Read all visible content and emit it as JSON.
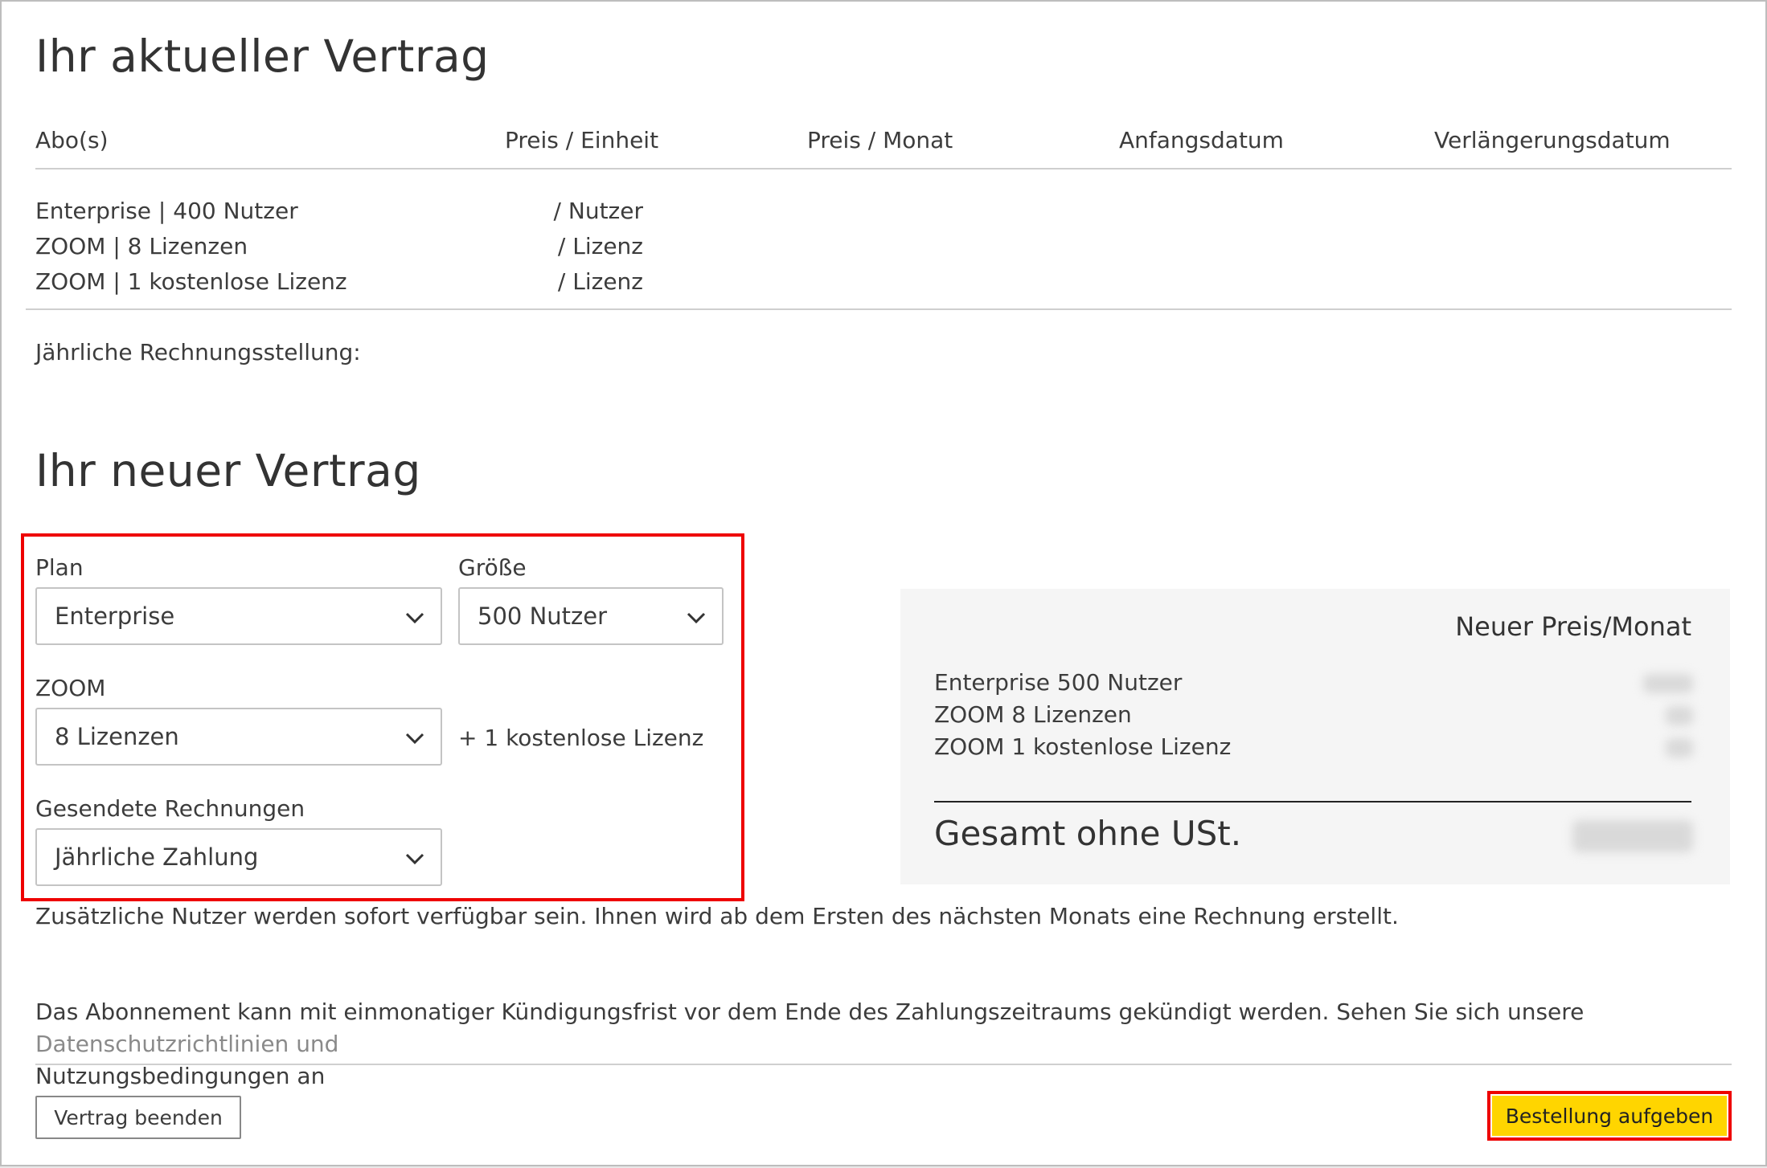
{
  "current": {
    "title": "Ihr aktueller Vertrag",
    "headers": [
      "Abo(s)",
      "Preis / Einheit",
      "Preis / Monat",
      "Anfangsdatum",
      "Verlängerungsdatum"
    ],
    "rows": [
      {
        "abo": "Enterprise | 400 Nutzer",
        "unit": "/ Nutzer"
      },
      {
        "abo": "ZOOM | 8 Lizenzen",
        "unit": "/ Lizenz"
      },
      {
        "abo": "ZOOM | 1 kostenlose Lizenz",
        "unit": "/ Lizenz"
      }
    ],
    "billing_label": "Jährliche Rechnungsstellung:"
  },
  "new": {
    "title": "Ihr neuer Vertrag",
    "plan_label": "Plan",
    "plan_value": "Enterprise",
    "size_label": "Größe",
    "size_value": "500 Nutzer",
    "zoom_label": "ZOOM",
    "zoom_value": "8 Lizenzen",
    "zoom_free_note": "+ 1 kostenlose Lizenz",
    "invoice_label": "Gesendete Rechnungen",
    "invoice_value": "Jährliche Zahlung"
  },
  "summary": {
    "title": "Neuer Preis/Monat",
    "items": [
      "Enterprise 500 Nutzer",
      "ZOOM 8 Lizenzen",
      "ZOOM 1 kostenlose Lizenz"
    ],
    "total_label": "Gesamt ohne USt."
  },
  "notes": {
    "immediate": "Zusätzliche Nutzer werden sofort verfügbar sein. Ihnen wird ab dem Ersten des nächsten Monats eine Rechnung erstellt.",
    "terms_text": "Das Abonnement kann mit einmonatiger Kündigungsfrist vor dem Ende des Zahlungszeitraums gekündigt werden. Sehen Sie sich unsere ",
    "terms_link": "Datenschutzrichtlinien und",
    "terms_line2": "Nutzungsbedingungen an"
  },
  "buttons": {
    "end_contract": "Vertrag beenden",
    "place_order": "Bestellung aufgeben"
  },
  "colors": {
    "highlight_red": "#ee0000",
    "order_button": "#ffd500",
    "summary_bg": "#f5f5f5"
  }
}
